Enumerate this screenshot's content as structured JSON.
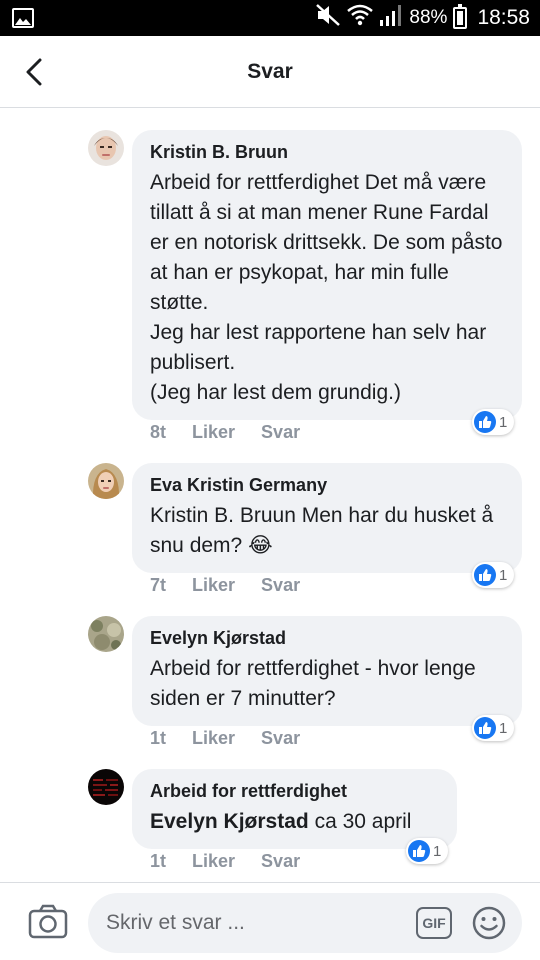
{
  "status_bar": {
    "battery": "88%",
    "time": "18:58"
  },
  "header": {
    "title": "Svar"
  },
  "comments": [
    {
      "author": "Kristin B. Bruun",
      "text": "Arbeid for rettferdighet Det må være tillatt å si at man mener Rune Fardal er en notorisk drittsekk. De som påsto at han er psykopat, har min fulle støtte.\nJeg har lest rapportene han selv har publisert.\n(Jeg har lest dem grundig.)",
      "time": "8t",
      "like_label": "Liker",
      "reply_label": "Svar",
      "reaction_count": "1"
    },
    {
      "author": "Eva Kristin Germany",
      "text": "Kristin B. Bruun Men har du husket å snu dem?",
      "emoji": "😂",
      "time": "7t",
      "like_label": "Liker",
      "reply_label": "Svar",
      "reaction_count": "1"
    },
    {
      "author": "Evelyn Kjørstad",
      "text": "Arbeid for rettferdighet - hvor lenge siden er 7 minutter?",
      "time": "1t",
      "like_label": "Liker",
      "reply_label": "Svar",
      "reaction_count": "1"
    },
    {
      "author": "Arbeid for rettferdighet",
      "mention": "Evelyn Kjørstad",
      "text": "ca 30 april",
      "time": "1t",
      "like_label": "Liker",
      "reply_label": "Svar",
      "reaction_count": "1"
    }
  ],
  "composer": {
    "placeholder": "Skriv et svar ...",
    "gif_label": "GIF"
  },
  "colors": {
    "accent": "#1877f2",
    "bubble": "#f0f2f5",
    "meta_text": "#8d949e"
  }
}
